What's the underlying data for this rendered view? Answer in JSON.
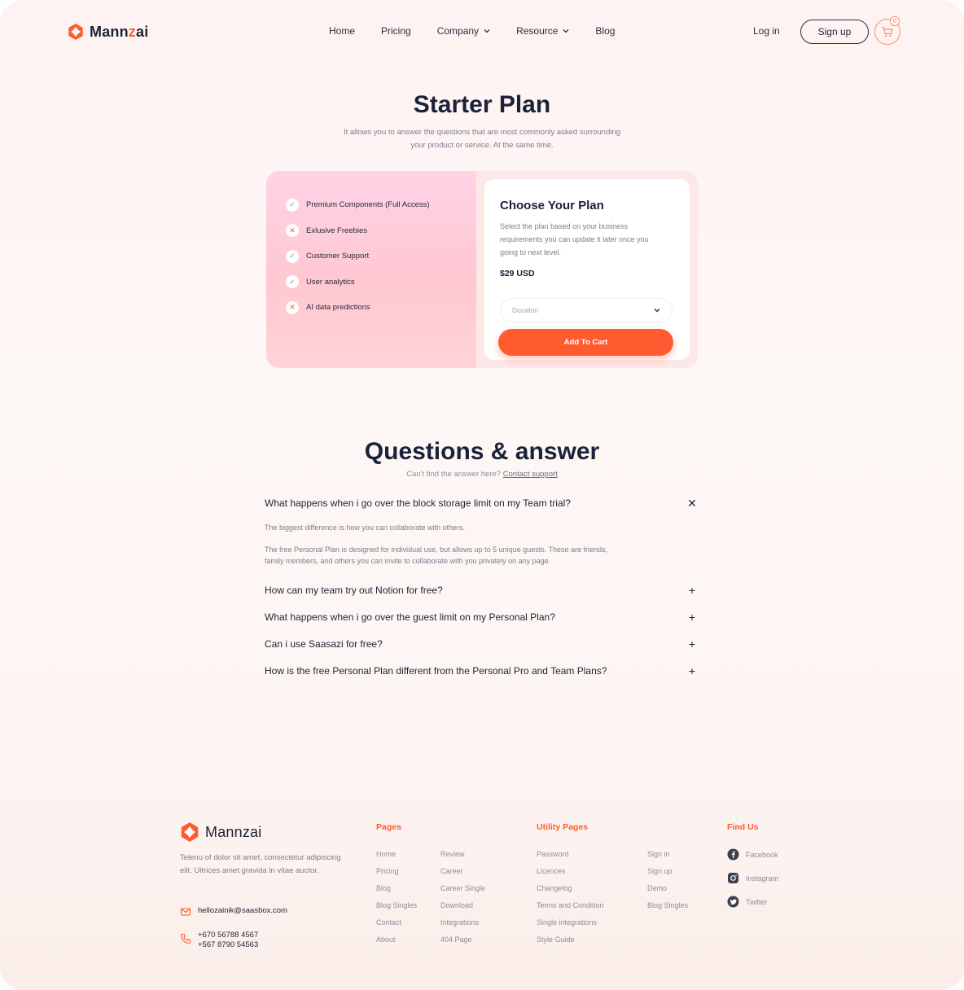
{
  "brand": {
    "name_start": "Mann",
    "name_accent": "z",
    "name_end": "ai",
    "accent_color": "#ff5a30"
  },
  "nav": {
    "items": [
      {
        "label": "Home",
        "dropdown": false
      },
      {
        "label": "Pricing",
        "dropdown": false
      },
      {
        "label": "Company",
        "dropdown": true
      },
      {
        "label": "Resource",
        "dropdown": true
      },
      {
        "label": "Blog",
        "dropdown": false
      }
    ],
    "login": "Log in",
    "signup": "Sign up",
    "cart_count": "0"
  },
  "hero": {
    "title": "Starter Plan",
    "subtitle": "It allows you to answer the questions that are most commonly asked surrounding your product or service. At the same time."
  },
  "plan": {
    "features": [
      {
        "label": "Premium Components (Full Access)",
        "included": true
      },
      {
        "label": "Exlusive Freebies",
        "included": false
      },
      {
        "label": "Customer Support",
        "included": true
      },
      {
        "label": "User analytics",
        "included": true
      },
      {
        "label": "AI data predictions",
        "included": false
      }
    ],
    "choose_title": "Choose Your Plan",
    "choose_desc": "Select the plan based on your business requirements you can update it later once you going to next level.",
    "price": "$29 USD",
    "duration_placeholder": "Duration",
    "add_to_cart": "Add To Cart"
  },
  "faq": {
    "title": "Questions & answer",
    "sub_text": "Can't find the answer here?",
    "sub_link": "Contact support",
    "open_question": "What happens when i go over the block storage limit on my Team trial?",
    "open_answer_1": "The biggest difference is how you can collaborate with others.",
    "open_answer_2": "The free Personal Plan is designed for individual use, but allows up to 5 unique guests. These are friends, family members, and others you can invite to collaborate with you privately on any page.",
    "questions": [
      "How can my team try out Notion for free?",
      "What happens when i go over the guest limit on my Personal Plan?",
      "Can i use Saasazi for free?",
      "How is the free Personal Plan different from the Personal Pro and Team Plans?"
    ]
  },
  "footer": {
    "desc": "Telenu of dolor sit amet, consectetur adipiscing elit. Ultrices amet gravida in vitae auctor.",
    "email": "hellozainik@saasbox.com",
    "phone_1": "+670 56788 4567",
    "phone_2": "+567 8790 54563",
    "pages_head": "Pages",
    "pages_col1": [
      "Home",
      "Pricing",
      "Blog",
      "Blog Singles",
      "Contact",
      "About"
    ],
    "pages_col2": [
      "Review",
      "Career",
      "Career Single",
      "Download",
      "Integrations",
      "404 Page"
    ],
    "utility_head": "Utility Pages",
    "utility_col1": [
      "Password",
      "Licences",
      "Changelog",
      "Terms and Condition",
      "Single integrations",
      "Style Guide"
    ],
    "utility_col2": [
      "Sign in",
      "Sign up",
      "Demo",
      "Blog Singles"
    ],
    "find_head": "Find Us",
    "social": [
      "Facebook",
      "Instagram",
      "Twitter"
    ]
  }
}
